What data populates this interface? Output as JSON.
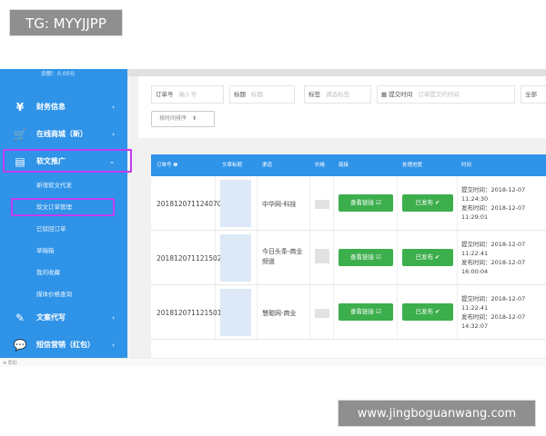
{
  "overlays": {
    "top_left_tag": "TG: MYYJJPP",
    "bottom_right_url": "www.jingboguanwang.com"
  },
  "sidebar": {
    "balance": "余额：0.00元",
    "items": [
      {
        "icon": "¥",
        "label": "财务信息",
        "arrow": "‹"
      },
      {
        "icon": "🛒",
        "label": "在线商城（新）",
        "arrow": "‹"
      },
      {
        "icon": "▤",
        "label": "软文推广",
        "arrow": "⌄"
      },
      {
        "icon": "✎",
        "label": "文案代写",
        "arrow": "‹"
      },
      {
        "icon": "💬",
        "label": "短信营销（红包）",
        "arrow": "‹"
      }
    ],
    "sub_items": [
      "新增软文代发",
      "软文订单管理",
      "已驳回订单",
      "草稿箱",
      "我的收藏",
      "媒体价格查询"
    ],
    "highlight_color": "#c23cf0"
  },
  "filters": {
    "order_no": {
      "label": "订单号",
      "placeholder": "输入号"
    },
    "title": {
      "label": "标题",
      "placeholder": "标题"
    },
    "tag": {
      "label": "标签",
      "placeholder": "请选标签"
    },
    "submit_time": {
      "label": "提交时间",
      "placeholder": "订单提交的时间"
    },
    "all": "全部",
    "sort_button": "按时间排序",
    "sort_arrow": "⬍"
  },
  "table": {
    "headers": [
      "订单号 ❶",
      "文章标题",
      "渠道",
      "价格",
      "链接",
      "处理进度",
      "时间"
    ],
    "rows": [
      {
        "order_no": "201812071124070",
        "media": "中华网-科技",
        "view_label": "查看链接 ☑",
        "status_label": "已发布 ✔",
        "submit_time": "提交时间：2018-12-07",
        "submit_clock": "11:24:30",
        "publish_time": "发布时间：2018-12-07",
        "publish_clock": "11:29:01"
      },
      {
        "order_no": "201812071121502",
        "media": "今日头条-商业频道",
        "view_label": "查看链接 ☑",
        "status_label": "已发布 ✔",
        "submit_time": "提交时间：2018-12-07",
        "submit_clock": "11:22:41",
        "publish_time": "发布时间：2018-12-07",
        "publish_clock": "16:00:04"
      },
      {
        "order_no": "201812071121501",
        "media": "慧聪网-商业",
        "view_label": "查看链接 ☑",
        "status_label": "已发布 ✔",
        "submit_time": "提交时间：2018-12-07",
        "submit_clock": "11:22:41",
        "publish_time": "发布时间：2018-12-07",
        "publish_clock": "14:32:07"
      }
    ]
  },
  "footer": {
    "hint": "⊕ 帮助"
  },
  "colors": {
    "primary": "#2f93e8",
    "success": "#3cae4c",
    "highlight": "#c23cf0"
  }
}
